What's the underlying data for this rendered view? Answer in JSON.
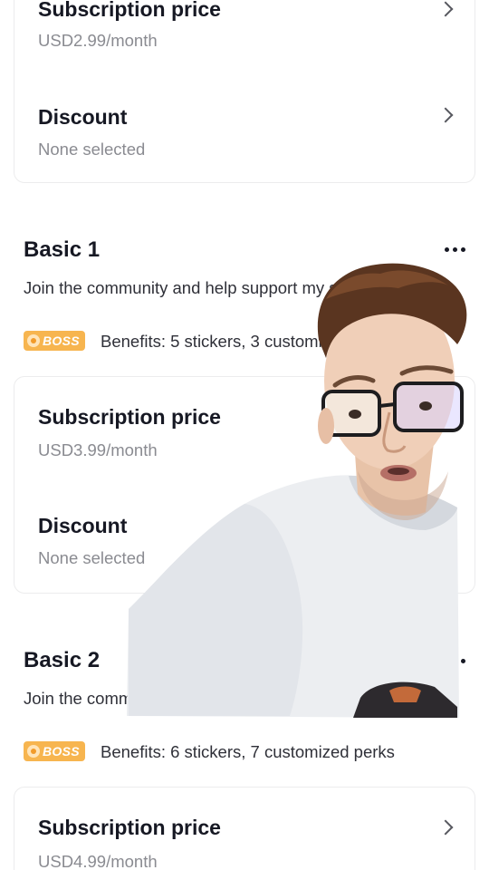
{
  "top_card": {
    "price_title": "Subscription price",
    "price_value": "USD2.99/month",
    "discount_title": "Discount",
    "discount_value": "None selected"
  },
  "tiers": [
    {
      "title": "Basic 1",
      "description": "Join the community and help support my shows.",
      "badge": "BOSS",
      "benefits": "Benefits: 5 stickers, 3 customized perks",
      "price_title": "Subscription price",
      "price_value": "USD3.99/month",
      "discount_title": "Discount",
      "discount_value": "None selected"
    },
    {
      "title": "Basic 2",
      "description": "Join the community and help support my shows.",
      "badge": "BOSS",
      "benefits": "Benefits: 6 stickers, 7 customized perks",
      "price_title": "Subscription price",
      "price_value": "USD4.99/month"
    }
  ],
  "icons": {
    "chevron": "chevron-right-icon",
    "more": "more-horizontal-icon",
    "badge": "boss-badge-icon"
  },
  "colors": {
    "badge": "#f7b54f",
    "title": "#161823",
    "secondary": "#8a8b91"
  }
}
